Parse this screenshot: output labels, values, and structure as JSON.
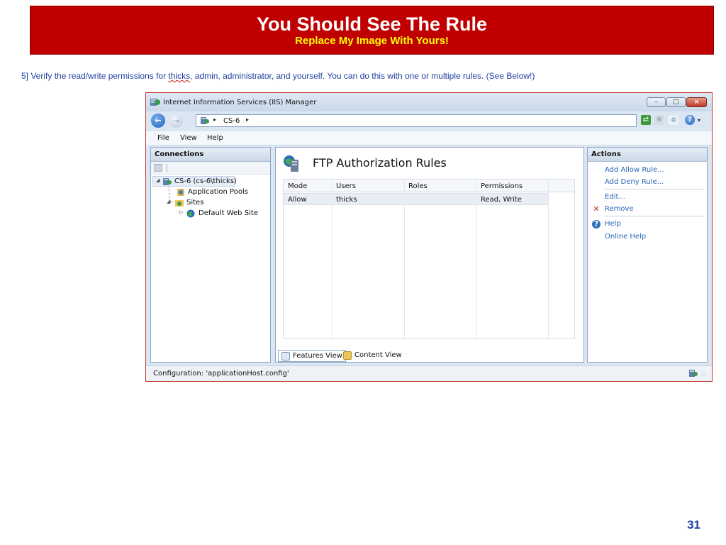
{
  "slide": {
    "title": "You Should See The Rule",
    "subtitle": "Replace My Image With Yours!",
    "instruction_before": "5] Verify the read/write permissions for ",
    "instruction_user": "thicks",
    "instruction_after": ", admin, administrator, and yourself. You can do this with one or multiple rules. (See Below!)",
    "page_number": "31",
    "colors": {
      "header_bg": "#c00000",
      "title": "#ffffff",
      "subtitle": "#ffff00",
      "instruction": "#1f3f9f"
    }
  },
  "window": {
    "title": "Internet Information Services (IIS) Manager",
    "controls": {
      "minimize": "–",
      "maximize": "□",
      "close": "×"
    },
    "address": {
      "node": "CS-6",
      "separator": "▸"
    },
    "toolbar_icons": [
      "connect-icon",
      "stop-icon",
      "home-icon",
      "help-icon"
    ],
    "help_dropdown": "▾",
    "menu": [
      "File",
      "View",
      "Help"
    ]
  },
  "connections": {
    "header": "Connections",
    "tree": [
      {
        "label": "CS-6 (cs-6\\thicks)",
        "toggle": "◢",
        "icon": "server-icon"
      },
      {
        "label": "Application Pools",
        "toggle": "",
        "icon": "app-pools-icon"
      },
      {
        "label": "Sites",
        "toggle": "◢",
        "icon": "sites-folder-icon"
      },
      {
        "label": "Default Web Site",
        "toggle": "▷",
        "icon": "globe-icon"
      }
    ]
  },
  "main": {
    "title": "FTP Authorization Rules",
    "columns": [
      "Mode",
      "Users",
      "Roles",
      "Permissions"
    ],
    "rows": [
      {
        "mode": "Allow",
        "users": "thicks",
        "roles": "",
        "permissions": "Read, Write"
      }
    ],
    "tabs": {
      "features": "Features View",
      "content": "Content View"
    }
  },
  "actions": {
    "header": "Actions",
    "items": [
      "Add Allow Rule...",
      "Add Deny Rule...",
      "Edit...",
      "Remove",
      "Help",
      "Online Help"
    ],
    "remove_glyph": "✕",
    "help_glyph": "?"
  },
  "status": {
    "text": "Configuration: 'applicationHost.config'",
    "grip": ".::"
  }
}
